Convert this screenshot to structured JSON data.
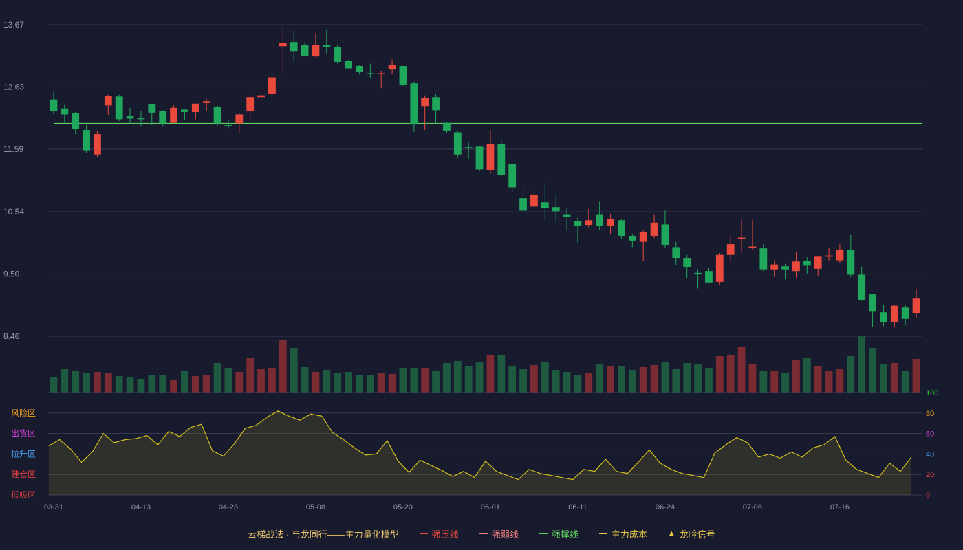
{
  "chart_data": {
    "type": "candlestick",
    "title": "",
    "price_axis": {
      "ylim": [
        8.46,
        13.67
      ],
      "ticks": [
        "13.67",
        "12.63",
        "11.59",
        "10.54",
        "9.50",
        "8.46"
      ]
    },
    "dates_labeled": [
      "03-31",
      "04-13",
      "04-23",
      "05-08",
      "05-20",
      "06-01",
      "06-11",
      "06-24",
      "07-06",
      "07-16"
    ],
    "label_every": 8,
    "candles": [
      [
        12.22,
        12.42,
        12.54,
        12.17,
        "down"
      ],
      [
        12.17,
        12.27,
        12.33,
        12.03,
        "down"
      ],
      [
        11.93,
        12.19,
        12.21,
        11.84,
        "down"
      ],
      [
        11.57,
        11.91,
        11.99,
        11.52,
        "down"
      ],
      [
        11.5,
        11.84,
        11.89,
        11.46,
        "up"
      ],
      [
        12.32,
        12.48,
        12.5,
        12.16,
        "up"
      ],
      [
        12.47,
        12.09,
        12.5,
        12.06,
        "down"
      ],
      [
        12.1,
        12.14,
        12.28,
        12.02,
        "down"
      ],
      [
        12.09,
        12.11,
        12.22,
        11.97,
        "down"
      ],
      [
        12.2,
        12.34,
        12.34,
        11.99,
        "down"
      ],
      [
        12.23,
        12.02,
        12.24,
        11.97,
        "down"
      ],
      [
        12.03,
        12.28,
        12.32,
        12.02,
        "up"
      ],
      [
        12.21,
        12.25,
        12.26,
        12.07,
        "down"
      ],
      [
        12.21,
        12.35,
        12.35,
        12.09,
        "up"
      ],
      [
        12.36,
        12.39,
        12.43,
        12.23,
        "up"
      ],
      [
        12.29,
        12.02,
        12.32,
        11.98,
        "down"
      ],
      [
        11.99,
        11.99,
        12.08,
        11.94,
        "down"
      ],
      [
        12.02,
        12.17,
        12.19,
        11.85,
        "up"
      ],
      [
        12.22,
        12.46,
        12.52,
        12.03,
        "up"
      ],
      [
        12.46,
        12.49,
        12.72,
        12.33,
        "up"
      ],
      [
        12.51,
        12.79,
        12.83,
        12.46,
        "up"
      ],
      [
        13.31,
        13.37,
        13.62,
        12.85,
        "up"
      ],
      [
        13.38,
        13.23,
        13.57,
        13.05,
        "down"
      ],
      [
        13.33,
        13.14,
        13.38,
        13.14,
        "down"
      ],
      [
        13.14,
        13.33,
        13.53,
        13.12,
        "up"
      ],
      [
        13.33,
        13.3,
        13.58,
        13.18,
        "down"
      ],
      [
        13.3,
        13.05,
        13.33,
        13.02,
        "down"
      ],
      [
        13.07,
        12.94,
        13.08,
        12.94,
        "down"
      ],
      [
        12.98,
        12.88,
        13.0,
        12.84,
        "down"
      ],
      [
        12.86,
        12.86,
        13.02,
        12.78,
        "down"
      ],
      [
        12.85,
        12.86,
        12.9,
        12.61,
        "up"
      ],
      [
        12.92,
        13.0,
        13.09,
        12.85,
        "up"
      ],
      [
        12.98,
        12.67,
        12.98,
        12.65,
        "down"
      ],
      [
        12.69,
        12.0,
        12.72,
        11.88,
        "down"
      ],
      [
        12.31,
        12.45,
        12.49,
        11.91,
        "up"
      ],
      [
        12.46,
        12.24,
        12.51,
        12.0,
        "down"
      ],
      [
        12.03,
        11.9,
        12.04,
        11.86,
        "down"
      ],
      [
        11.87,
        11.5,
        11.89,
        11.44,
        "down"
      ],
      [
        11.62,
        11.6,
        11.7,
        11.43,
        "down"
      ],
      [
        11.63,
        11.25,
        11.64,
        11.22,
        "down"
      ],
      [
        11.24,
        11.67,
        11.91,
        11.18,
        "up"
      ],
      [
        11.67,
        11.16,
        11.75,
        11.14,
        "down"
      ],
      [
        11.34,
        10.95,
        11.34,
        10.88,
        "down"
      ],
      [
        10.77,
        10.56,
        11.0,
        10.53,
        "down"
      ],
      [
        10.63,
        10.83,
        10.93,
        10.56,
        "up"
      ],
      [
        10.7,
        10.6,
        11.02,
        10.4,
        "down"
      ],
      [
        10.62,
        10.55,
        10.83,
        10.37,
        "down"
      ],
      [
        10.49,
        10.46,
        10.61,
        10.22,
        "down"
      ],
      [
        10.39,
        10.3,
        10.44,
        10.03,
        "down"
      ],
      [
        10.31,
        10.4,
        10.59,
        10.28,
        "up"
      ],
      [
        10.49,
        10.3,
        10.71,
        10.23,
        "down"
      ],
      [
        10.3,
        10.42,
        10.5,
        10.17,
        "up"
      ],
      [
        10.4,
        10.14,
        10.42,
        10.09,
        "down"
      ],
      [
        10.13,
        10.06,
        10.17,
        9.95,
        "down"
      ],
      [
        10.04,
        10.2,
        10.24,
        9.72,
        "up"
      ],
      [
        10.14,
        10.36,
        10.49,
        10.1,
        "up"
      ],
      [
        10.33,
        9.99,
        10.56,
        9.94,
        "down"
      ],
      [
        9.95,
        9.77,
        10.04,
        9.65,
        "down"
      ],
      [
        9.77,
        9.61,
        9.82,
        9.43,
        "down"
      ],
      [
        9.52,
        9.52,
        9.58,
        9.26,
        "down"
      ],
      [
        9.55,
        9.36,
        9.6,
        9.35,
        "down"
      ],
      [
        9.37,
        9.82,
        9.85,
        9.31,
        "up"
      ],
      [
        9.82,
        10.0,
        10.15,
        9.7,
        "up"
      ],
      [
        10.09,
        10.11,
        10.42,
        9.87,
        "up"
      ],
      [
        9.95,
        9.96,
        10.4,
        9.91,
        "up"
      ],
      [
        9.93,
        9.58,
        10.0,
        9.55,
        "down"
      ],
      [
        9.58,
        9.66,
        9.73,
        9.45,
        "up"
      ],
      [
        9.63,
        9.58,
        9.67,
        9.41,
        "down"
      ],
      [
        9.55,
        9.71,
        9.87,
        9.44,
        "up"
      ],
      [
        9.72,
        9.64,
        9.78,
        9.51,
        "down"
      ],
      [
        9.59,
        9.79,
        9.8,
        9.47,
        "up"
      ],
      [
        9.79,
        9.81,
        9.94,
        9.73,
        "up"
      ],
      [
        9.73,
        9.91,
        10.0,
        9.68,
        "up"
      ],
      [
        9.91,
        9.49,
        10.15,
        9.45,
        "down"
      ],
      [
        9.49,
        9.07,
        9.62,
        9.05,
        "down"
      ],
      [
        9.16,
        8.87,
        9.17,
        8.62,
        "down"
      ],
      [
        8.86,
        8.7,
        8.98,
        8.63,
        "down"
      ],
      [
        8.69,
        8.97,
        8.99,
        8.62,
        "up"
      ],
      [
        8.94,
        8.75,
        8.98,
        8.65,
        "down"
      ],
      [
        8.85,
        9.09,
        9.25,
        8.76,
        "up"
      ]
    ],
    "volume": [
      22,
      34,
      32,
      28,
      30,
      29,
      24,
      23,
      20,
      26,
      25,
      18,
      31,
      24,
      26,
      43,
      36,
      30,
      51,
      34,
      36,
      77,
      65,
      37,
      30,
      33,
      28,
      30,
      25,
      26,
      29,
      27,
      36,
      36,
      36,
      32,
      43,
      46,
      39,
      44,
      54,
      54,
      38,
      35,
      40,
      44,
      33,
      30,
      25,
      28,
      41,
      38,
      39,
      33,
      37,
      40,
      44,
      35,
      43,
      41,
      36,
      53,
      54,
      67,
      41,
      31,
      31,
      29,
      47,
      50,
      39,
      32,
      34,
      53,
      83,
      65,
      41,
      43,
      31,
      49
    ],
    "volume_up_color": "#7a2c32",
    "volume_down_color": "#1e5a40",
    "indicator": {
      "ylim": [
        0,
        100
      ],
      "ticks": [
        "100",
        "80",
        "60",
        "40",
        "20",
        "0"
      ],
      "tick_colors": [
        "#33e033",
        "#f0a020",
        "#e040e0",
        "#4aa0f0",
        "#e04040",
        "#e04040"
      ],
      "zones": [
        {
          "label": "风险区",
          "level": 80,
          "color": "#f0a020"
        },
        {
          "label": "出货区",
          "level": 60,
          "color": "#e040e0"
        },
        {
          "label": "拉升区",
          "level": 40,
          "color": "#4aa0f0"
        },
        {
          "label": "建仓区",
          "level": 20,
          "color": "#e04040"
        },
        {
          "label": "低吸区",
          "level": 0,
          "color": "#e04040"
        }
      ],
      "values": [
        48,
        54,
        45,
        32,
        42,
        60,
        51,
        54,
        55,
        58,
        49,
        62,
        57,
        66,
        69,
        43,
        38,
        50,
        65,
        68,
        76,
        82,
        77,
        73,
        79,
        77,
        61,
        54,
        46,
        39,
        40,
        53,
        33,
        22,
        34,
        29,
        24,
        18,
        23,
        17,
        33,
        23,
        19,
        15,
        25,
        21,
        19,
        17,
        15,
        25,
        23,
        35,
        23,
        21,
        32,
        44,
        31,
        25,
        21,
        19,
        17,
        41,
        49,
        56,
        51,
        37,
        40,
        36,
        42,
        37,
        46,
        49,
        57,
        34,
        25,
        21,
        17,
        31,
        23,
        37
      ],
      "line_color": "#d4c21a"
    },
    "lines": {
      "weak_level": 13.33,
      "support_level": 12.02
    },
    "colors": {
      "up": "#ea4a3c",
      "down": "#1fa85c",
      "weak": "#f08080",
      "support": "#5fd35f"
    },
    "legend": {
      "title": "云梯战法 · 与龙同行——主力量化模型",
      "items": [
        {
          "label": "强压线",
          "style": "solid",
          "color": "#ea4a3c",
          "marker": "line"
        },
        {
          "label": "强弱线",
          "style": "dash",
          "color": "#f08080",
          "marker": "line"
        },
        {
          "label": "强撑线",
          "style": "solid",
          "color": "#5fd35f",
          "marker": "line"
        },
        {
          "label": "主力成本",
          "style": "dash",
          "color": "#e8c84a",
          "marker": "line"
        },
        {
          "label": "龙吟信号",
          "style": "triangle",
          "color": "#e8c84a",
          "marker": "▲"
        }
      ]
    }
  }
}
